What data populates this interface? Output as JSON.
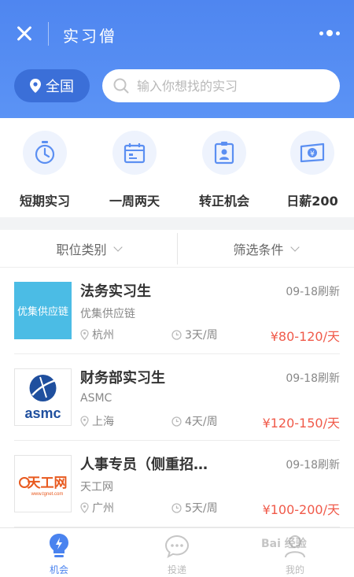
{
  "app": {
    "title": "实习僧"
  },
  "location": {
    "label": "全国"
  },
  "search": {
    "placeholder": "输入你想找的实习"
  },
  "categories": [
    {
      "label": "短期实习",
      "icon": "stopwatch-icon"
    },
    {
      "label": "一周两天",
      "icon": "calendar-icon"
    },
    {
      "label": "转正机会",
      "icon": "id-badge-icon"
    },
    {
      "label": "日薪200",
      "icon": "yen-note-icon"
    }
  ],
  "filters": {
    "position": "职位类别",
    "conditions": "筛选条件"
  },
  "jobs": [
    {
      "title": "法务实习生",
      "company": "优集供应链",
      "city": "杭州",
      "days": "3天/周",
      "salary": "¥80-120/天",
      "refresh": "09-18刷新",
      "logo_text": "优集供应链"
    },
    {
      "title": "财务部实习生",
      "company": "ASMC",
      "city": "上海",
      "days": "4天/周",
      "salary": "¥120-150/天",
      "refresh": "09-18刷新",
      "logo_text": "asmc"
    },
    {
      "title": "人事专员（侧重招…",
      "company": "天工网",
      "city": "广州",
      "days": "5天/周",
      "salary": "¥100-200/天",
      "refresh": "09-18刷新",
      "logo_text": "天工网",
      "logo_sub": "www.tgnet.com"
    }
  ],
  "tabs": [
    {
      "label": "机会",
      "icon": "lightning-bulb-icon"
    },
    {
      "label": "投递",
      "icon": "chat-bubble-icon"
    },
    {
      "label": "我的",
      "icon": "person-icon"
    }
  ],
  "watermark": "Bai 经验",
  "colors": {
    "primary": "#4f86f0",
    "accent_dark": "#3b6fd8",
    "salary": "#f05a4a"
  }
}
